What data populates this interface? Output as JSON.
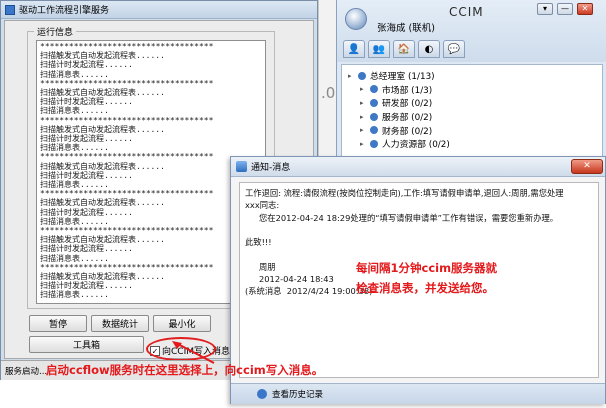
{
  "service_window": {
    "title": "驱动工作流程引擎服务",
    "group_label": "运行信息",
    "log_lines": [
      "************************************",
      "扫描触发式自动发起流程表......",
      "扫描计时发起流程......",
      "扫描消息表......",
      "************************************",
      "扫描触发式自动发起流程表......",
      "扫描计时发起流程......",
      "扫描消息表......",
      "************************************",
      "扫描触发式自动发起流程表......",
      "扫描计时发起流程......",
      "扫描消息表......",
      "************************************",
      "扫描触发式自动发起流程表......",
      "扫描计时发起流程......",
      "扫描消息表......",
      "************************************",
      "扫描触发式自动发起流程表......",
      "扫描计时发起流程......",
      "扫描消息表......",
      "************************************",
      "扫描触发式自动发起流程表......",
      "扫描计时发起流程......",
      "扫描消息表......",
      "************************************",
      "扫描触发式自动发起流程表......",
      "扫描计时发起流程......",
      "扫描消息表......"
    ],
    "buttons": {
      "pause": "暂停",
      "stats": "数据统计",
      "minimize": "最小化",
      "toolbox": "工具箱"
    },
    "checkbox_label": "向CCIM写入消息",
    "checkbox_checked": true,
    "status": "服务启动..."
  },
  "ghost_char": ".0",
  "ccim": {
    "app_name": "CCIM",
    "user": "张海成 (联机)",
    "window_buttons": [
      "▾",
      "—",
      "✕"
    ],
    "tabs": [
      "👤",
      "👥",
      "🏠",
      "◐",
      "💬"
    ],
    "tree": [
      {
        "label": "总经理室 (1/13)",
        "level": 0
      },
      {
        "label": "市场部 (1/3)",
        "level": 1
      },
      {
        "label": "研发部 (0/2)",
        "level": 1
      },
      {
        "label": "服务部 (0/2)",
        "level": 1
      },
      {
        "label": "财务部 (0/2)",
        "level": 1
      },
      {
        "label": "人力资源部 (0/2)",
        "level": 1
      }
    ]
  },
  "notification": {
    "title": "通知-消息",
    "close_label": "✕",
    "line1": "工作退回: 流程:请假流程(按岗位控制走向),工作:填写请假申请单,退回人:周朋,需您处理",
    "greeting": "xxx同志:",
    "body": "您在2012-04-24 18:29处理的“填写请假申请单”工作有错误，需要您重新办理。",
    "salute": "此致!!!",
    "signer": "周朋",
    "date": "2012-04-24 18:43",
    "system": "(系统消息  2012/4/24 19:00:38)",
    "footer": "查看历史记录"
  },
  "annotations": {
    "right_line1": "每间隔1分钟ccim服务器就",
    "right_line2": "检查消息表，并发送给您。",
    "bottom": "启动ccflow服务时在这里选择上，向ccim写入消息。"
  },
  "colors": {
    "annotation": "#e3191c",
    "window_frame": "#7f95b3"
  }
}
